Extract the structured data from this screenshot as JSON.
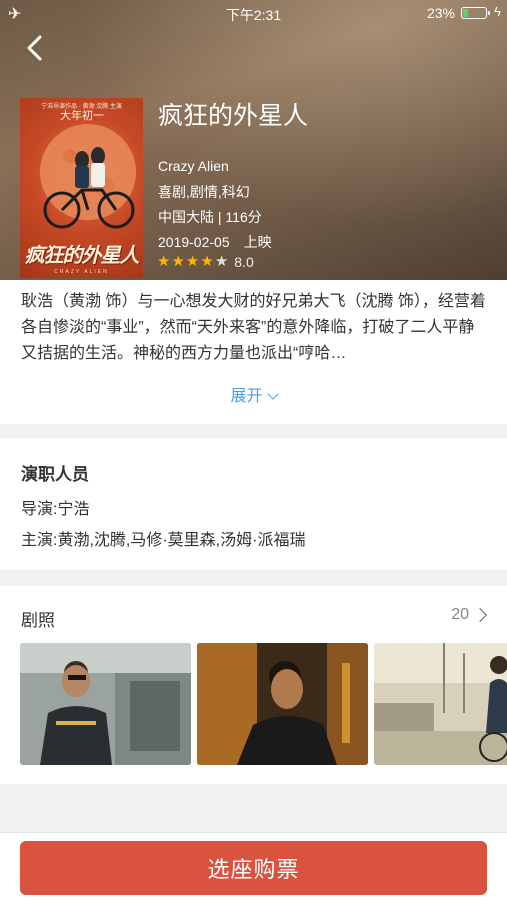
{
  "status_bar": {
    "time": "下午2:31",
    "battery_percent": "23%",
    "battery_level": 0.23,
    "icons": [
      "airplane-icon",
      "battery-icon",
      "charging-icon"
    ]
  },
  "nav": {
    "back_icon": "chevron-left-icon"
  },
  "movie": {
    "title": "疯狂的外星人",
    "english_title": "Crazy Alien",
    "genres": "喜剧,剧情,科幻",
    "region_runtime": "中国大陆 | 116分",
    "release": "2019-02-05　上映",
    "rating": "8.0",
    "stars_filled": 4,
    "stars_total": 5,
    "poster": {
      "top_text": "宁浩导演作品 · 黄渤 沈腾 主演",
      "day_text": "大年初一",
      "title_art": "疯狂的外星人",
      "sub_art": "CRAZY ALIEN"
    }
  },
  "description": {
    "text": "耿浩（黄渤 饰）与一心想发大财的好兄弟大飞（沈腾 饰），经营着各自惨淡的“事业”，然而“天外来客”的意外降临，打破了二人平静又拮据的生活。神秘的西方力量也派出“哼哈…",
    "expand_label": "展开"
  },
  "cast": {
    "title": "演职人员",
    "director": "导演:宁浩",
    "starring": "主演:黄渤,沈腾,马修·莫里森,汤姆·派福瑞"
  },
  "stills": {
    "title": "剧照",
    "count": "20"
  },
  "bottom": {
    "buy_label": "选座购票"
  },
  "colors": {
    "accent": "#d9533e",
    "link": "#4a9ee8",
    "star": "#ffb400"
  }
}
